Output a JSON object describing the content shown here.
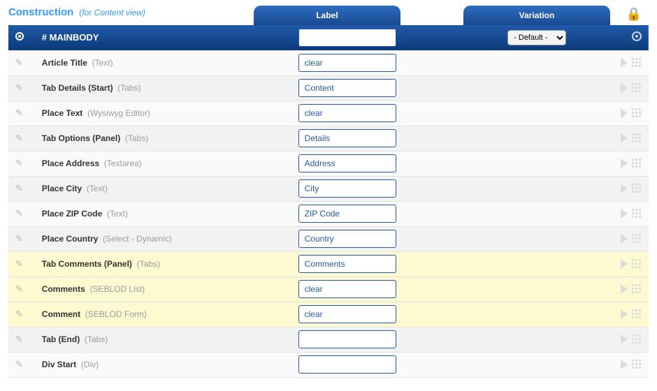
{
  "header": {
    "title": "Construction",
    "subtitle": "(for Content view)",
    "tab_label": "Label",
    "tab_variation": "Variation"
  },
  "mainbody": {
    "title": "# MAINBODY",
    "label_value": "",
    "variation_value": "- Default -"
  },
  "rows": [
    {
      "name": "Article Title",
      "type": "(Text)",
      "label": "clear",
      "hl": false
    },
    {
      "name": "Tab Details (Start)",
      "type": "(Tabs)",
      "label": "Content",
      "hl": false
    },
    {
      "name": "Place Text",
      "type": "(Wysiwyg Editor)",
      "label": "clear",
      "hl": false
    },
    {
      "name": "Tab Options (Panel)",
      "type": "(Tabs)",
      "label": "Details",
      "hl": false
    },
    {
      "name": "Place Address",
      "type": "(Textarea)",
      "label": "Address",
      "hl": false
    },
    {
      "name": "Place City",
      "type": "(Text)",
      "label": "City",
      "hl": false
    },
    {
      "name": "Place ZIP Code",
      "type": "(Text)",
      "label": "ZIP Code",
      "hl": false
    },
    {
      "name": "Place Country",
      "type": "(Select - Dynamic)",
      "label": "Country",
      "hl": false
    },
    {
      "name": "Tab Comments (Panel)",
      "type": "(Tabs)",
      "label": "Comments",
      "hl": true
    },
    {
      "name": "Comments",
      "type": "(SEBLOD List)",
      "label": "clear",
      "hl": true
    },
    {
      "name": "Comment",
      "type": "(SEBLOD Form)",
      "label": "clear",
      "hl": true
    },
    {
      "name": "Tab (End)",
      "type": "(Tabs)",
      "label": "",
      "hl": false
    },
    {
      "name": "Div Start",
      "type": "(Div)",
      "label": "",
      "hl": false
    }
  ]
}
